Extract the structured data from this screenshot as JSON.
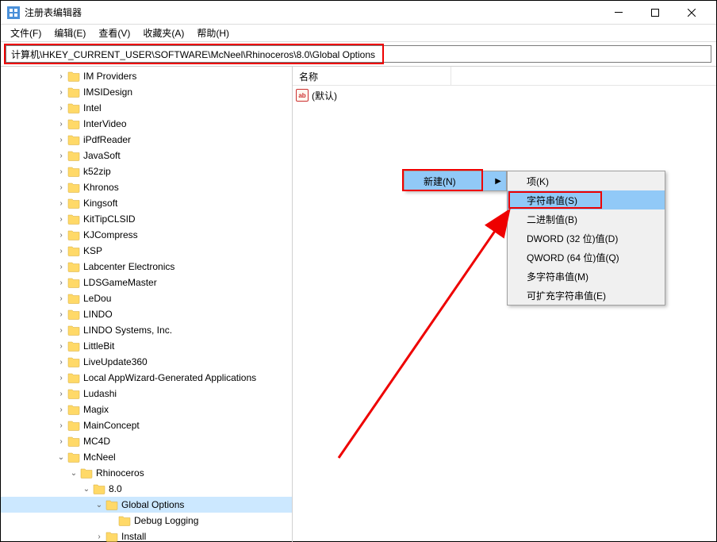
{
  "title": "注册表编辑器",
  "menu": {
    "file": "文件(F)",
    "edit": "编辑(E)",
    "view": "查看(V)",
    "fav": "收藏夹(A)",
    "help": "帮助(H)"
  },
  "address": "计算机\\HKEY_CURRENT_USER\\SOFTWARE\\McNeel\\Rhinoceros\\8.0\\Global Options",
  "list": {
    "col_name": "名称",
    "default": "(默认)"
  },
  "ctx": {
    "new": "新建(N)",
    "key": "项(K)",
    "string": "字符串值(S)",
    "binary": "二进制值(B)",
    "dword": "DWORD (32 位)值(D)",
    "qword": "QWORD (64 位)值(Q)",
    "multistr": "多字符串值(M)",
    "exstr": "可扩充字符串值(E)"
  },
  "tree": [
    {
      "label": "IM Providers",
      "depth": 3
    },
    {
      "label": "IMSIDesign",
      "depth": 3
    },
    {
      "label": "Intel",
      "depth": 3
    },
    {
      "label": "InterVideo",
      "depth": 3
    },
    {
      "label": "iPdfReader",
      "depth": 3
    },
    {
      "label": "JavaSoft",
      "depth": 3
    },
    {
      "label": "k52zip",
      "depth": 3
    },
    {
      "label": "Khronos",
      "depth": 3
    },
    {
      "label": "Kingsoft",
      "depth": 3
    },
    {
      "label": "KitTipCLSID",
      "depth": 3
    },
    {
      "label": "KJCompress",
      "depth": 3
    },
    {
      "label": "KSP",
      "depth": 3
    },
    {
      "label": "Labcenter Electronics",
      "depth": 3
    },
    {
      "label": "LDSGameMaster",
      "depth": 3
    },
    {
      "label": "LeDou",
      "depth": 3
    },
    {
      "label": "LINDO",
      "depth": 3
    },
    {
      "label": "LINDO Systems, Inc.",
      "depth": 3
    },
    {
      "label": "LittleBit",
      "depth": 3
    },
    {
      "label": "LiveUpdate360",
      "depth": 3
    },
    {
      "label": "Local AppWizard-Generated Applications",
      "depth": 3
    },
    {
      "label": "Ludashi",
      "depth": 3
    },
    {
      "label": "Magix",
      "depth": 3
    },
    {
      "label": "MainConcept",
      "depth": 3
    },
    {
      "label": "MC4D",
      "depth": 3
    },
    {
      "label": "McNeel",
      "depth": 3,
      "expanded": true
    },
    {
      "label": "Rhinoceros",
      "depth": 4,
      "expanded": true
    },
    {
      "label": "8.0",
      "depth": 5,
      "expanded": true
    },
    {
      "label": "Global Options",
      "depth": 6,
      "expanded": true,
      "selected": true
    },
    {
      "label": "Debug Logging",
      "depth": 7
    },
    {
      "label": "Install",
      "depth": 6
    }
  ]
}
